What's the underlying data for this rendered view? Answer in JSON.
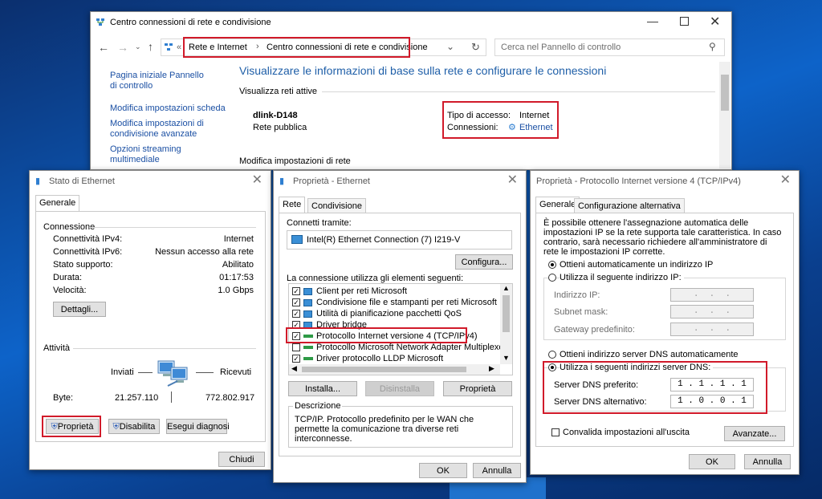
{
  "control_panel": {
    "title": "Centro connessioni di rete e condivisione",
    "breadcrumb_prefix": "«",
    "breadcrumb": [
      "Rete e Internet",
      "Centro connessioni di rete e condivisione"
    ],
    "breadcrumb_sep": "›",
    "search_placeholder": "Cerca nel Pannello di controllo",
    "sidebar": [
      "Pagina iniziale Pannello di controllo",
      "Modifica impostazioni scheda",
      "Modifica impostazioni di condivisione avanzate",
      "Opzioni streaming multimediale"
    ],
    "heading": "Visualizzare le informazioni di base sulla rete e configurare le connessioni",
    "active_networks_label": "Visualizza reti attive",
    "network_name": "dlink-D148",
    "network_type": "Rete pubblica",
    "access_type_label": "Tipo di accesso:",
    "access_type_value": "Internet",
    "connections_label": "Connessioni:",
    "connections_value": "Ethernet",
    "modify_settings_label": "Modifica impostazioni di rete"
  },
  "status_window": {
    "title": "Stato di Ethernet",
    "tab": "Generale",
    "connection_group": "Connessione",
    "rows": [
      {
        "label": "Connettività IPv4:",
        "value": "Internet"
      },
      {
        "label": "Connettività IPv6:",
        "value": "Nessun accesso alla rete"
      },
      {
        "label": "Stato supporto:",
        "value": "Abilitato"
      },
      {
        "label": "Durata:",
        "value": "01:17:53"
      },
      {
        "label": "Velocità:",
        "value": "1.0 Gbps"
      }
    ],
    "details_button": "Dettagli...",
    "activity_group": "Attività",
    "sent_label": "Inviati",
    "received_label": "Ricevuti",
    "bytes_label": "Byte:",
    "bytes_sent": "21.257.110",
    "bytes_received": "772.802.917",
    "properties_button": "Proprietà",
    "disable_button": "Disabilita",
    "diagnose_button": "Esegui diagnosi",
    "close_button": "Chiudi"
  },
  "eth_props": {
    "title": "Proprietà - Ethernet",
    "tabs": [
      "Rete",
      "Condivisione"
    ],
    "connect_using_label": "Connetti tramite:",
    "adapter": "Intel(R) Ethernet Connection (7) I219-V",
    "configure_button": "Configura...",
    "items_label": "La connessione utilizza gli elementi seguenti:",
    "items": [
      {
        "label": "Client per reti Microsoft",
        "checked": true
      },
      {
        "label": "Condivisione file e stampanti per reti Microsoft",
        "checked": true
      },
      {
        "label": "Utilità di pianificazione pacchetti QoS",
        "checked": true
      },
      {
        "label": "Driver bridge",
        "checked": true
      },
      {
        "label": "Protocollo Internet versione 4 (TCP/IPv4)",
        "checked": true
      },
      {
        "label": "Protocollo Microsoft Network Adapter Multiplexor",
        "checked": false
      },
      {
        "label": "Driver protocollo LLDP Microsoft",
        "checked": true
      }
    ],
    "install_button": "Installa...",
    "uninstall_button": "Disinstalla",
    "properties_button": "Proprietà",
    "description_label": "Descrizione",
    "description": "TCP/IP. Protocollo predefinito per le WAN che permette la comunicazione tra diverse reti interconnesse.",
    "ok_button": "OK",
    "cancel_button": "Annulla"
  },
  "ipv4_props": {
    "title": "Proprietà - Protocollo Internet versione 4 (TCP/IPv4)",
    "tabs": [
      "Generale",
      "Configurazione alternativa"
    ],
    "intro": "È possibile ottenere l'assegnazione automatica delle impostazioni IP se la rete supporta tale caratteristica. In caso contrario, sarà necessario richiedere all'amministratore di rete le impostazioni IP corrette.",
    "auto_ip_label": "Ottieni automaticamente un indirizzo IP",
    "manual_ip_label": "Utilizza il seguente indirizzo IP:",
    "ip_label": "Indirizzo IP:",
    "subnet_label": "Subnet mask:",
    "gateway_label": "Gateway predefinito:",
    "empty_ip": " .  .  . ",
    "auto_dns_label": "Ottieni indirizzo server DNS automaticamente",
    "manual_dns_label": "Utilizza i seguenti indirizzi server DNS:",
    "preferred_dns_label": "Server DNS preferito:",
    "preferred_dns_value": "1 . 1 . 1 . 1",
    "alternate_dns_label": "Server DNS alternativo:",
    "alternate_dns_value": "1 . 0 . 0 . 1",
    "validate_label": "Convalida impostazioni all'uscita",
    "advanced_button": "Avanzate...",
    "ok_button": "OK",
    "cancel_button": "Annulla"
  },
  "colors": {
    "highlight": "#d11a2a",
    "link": "#1a4fa3",
    "heading": "#1f5fa8"
  }
}
